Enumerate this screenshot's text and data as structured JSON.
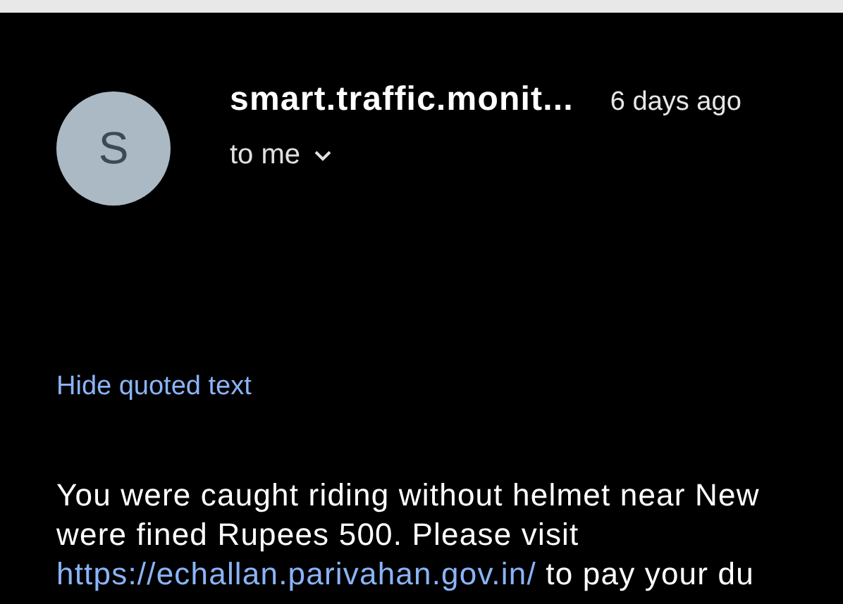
{
  "message": {
    "avatar_letter": "S",
    "sender": "smart.traffic.monit...",
    "time": "6 days ago",
    "recipient": "to me"
  },
  "hide_quoted": "Hide quoted text",
  "body": {
    "lines": [
      "You were caught riding without helmet near New",
      "were fined Rupees 500. Please visit"
    ],
    "link": "https://echallan.parivahan.gov.in/",
    "after_link": " to pay your du"
  }
}
